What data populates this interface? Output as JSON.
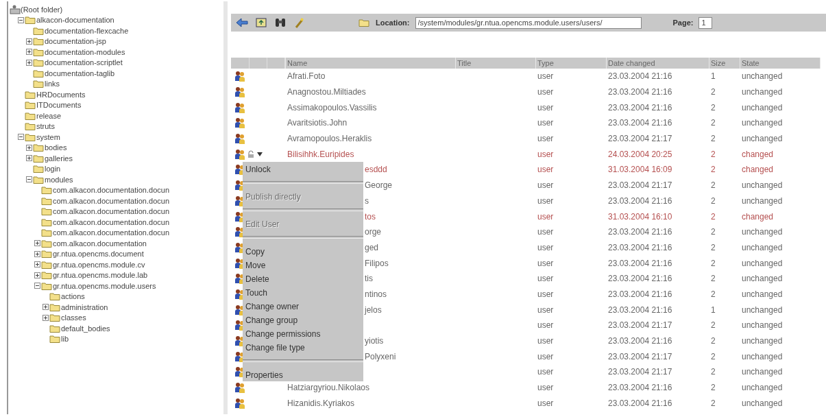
{
  "tree": {
    "label": "(Root folder)",
    "children": [
      {
        "label": "alkacon-documentation",
        "expanded": true,
        "children": [
          {
            "label": "documentation-flexcache"
          },
          {
            "label": "documentation-jsp",
            "expanded": false
          },
          {
            "label": "documentation-modules",
            "expanded": false
          },
          {
            "label": "documentation-scriptlet",
            "expanded": false
          },
          {
            "label": "documentation-taglib"
          },
          {
            "label": "links"
          }
        ]
      },
      {
        "label": "HRDocuments"
      },
      {
        "label": "ITDocuments"
      },
      {
        "label": "release"
      },
      {
        "label": "struts"
      },
      {
        "label": "system",
        "expanded": true,
        "children": [
          {
            "label": "bodies",
            "expanded": false
          },
          {
            "label": "galleries",
            "expanded": false
          },
          {
            "label": "login"
          },
          {
            "label": "modules",
            "expanded": true,
            "children": [
              {
                "label": "com.alkacon.documentation.docun"
              },
              {
                "label": "com.alkacon.documentation.docun"
              },
              {
                "label": "com.alkacon.documentation.docun"
              },
              {
                "label": "com.alkacon.documentation.docun"
              },
              {
                "label": "com.alkacon.documentation.docun"
              },
              {
                "label": "com.alkacon.documentation",
                "expanded": false
              },
              {
                "label": "gr.ntua.opencms.document",
                "expanded": false
              },
              {
                "label": "gr.ntua.opencms.module.cv",
                "expanded": false
              },
              {
                "label": "gr.ntua.opencms.module.lab",
                "expanded": false
              },
              {
                "label": "gr.ntua.opencms.module.users",
                "expanded": true,
                "children": [
                  {
                    "label": "actions"
                  },
                  {
                    "label": "administration",
                    "expanded": false
                  },
                  {
                    "label": "classes",
                    "expanded": false
                  },
                  {
                    "label": "default_bodies"
                  },
                  {
                    "label": "lib"
                  }
                ]
              }
            ]
          }
        ]
      }
    ]
  },
  "toolbar": {
    "location_label": "Location:",
    "location": "/system/modules/gr.ntua.opencms.module.users/users/",
    "page_label": "Page:",
    "page": "1"
  },
  "table": {
    "columns": [
      "Name",
      "Title",
      "Type",
      "Date changed",
      "Size",
      "State"
    ],
    "rows": [
      {
        "name": "Afrati.Foto",
        "type": "user",
        "date": "23.03.2004 21:16",
        "size": "1",
        "state": "unchanged",
        "modified": false,
        "locked": false,
        "covered": false
      },
      {
        "name": "Anagnostou.Miltiades",
        "type": "user",
        "date": "23.03.2004 21:16",
        "size": "2",
        "state": "unchanged",
        "modified": false,
        "locked": false,
        "covered": false
      },
      {
        "name": "Assimakopoulos.Vassilis",
        "type": "user",
        "date": "23.03.2004 21:16",
        "size": "2",
        "state": "unchanged",
        "modified": false,
        "locked": false,
        "covered": false
      },
      {
        "name": "Avaritsiotis.John",
        "type": "user",
        "date": "23.03.2004 21:16",
        "size": "2",
        "state": "unchanged",
        "modified": false,
        "locked": false,
        "covered": false
      },
      {
        "name": "Avramopoulos.Heraklis",
        "type": "user",
        "date": "23.03.2004 21:17",
        "size": "2",
        "state": "unchanged",
        "modified": false,
        "locked": false,
        "covered": false
      },
      {
        "name": "Bilisihhk.Euripides",
        "type": "user",
        "date": "24.03.2004 20:25",
        "size": "2",
        "state": "changed",
        "modified": true,
        "locked": true,
        "covered": false
      },
      {
        "name": "esddd",
        "type": "user",
        "date": "31.03.2004 16:09",
        "size": "2",
        "state": "changed",
        "modified": true,
        "covered": true
      },
      {
        "name": "George",
        "type": "user",
        "date": "23.03.2004 21:17",
        "size": "2",
        "state": "unchanged",
        "modified": false,
        "covered": true
      },
      {
        "name": "s",
        "type": "user",
        "date": "23.03.2004 21:16",
        "size": "2",
        "state": "unchanged",
        "modified": false,
        "covered": true
      },
      {
        "name": "tos",
        "type": "user",
        "date": "31.03.2004 16:10",
        "size": "2",
        "state": "changed",
        "modified": true,
        "covered": true
      },
      {
        "name": "orge",
        "type": "user",
        "date": "23.03.2004 21:16",
        "size": "2",
        "state": "unchanged",
        "modified": false,
        "covered": true
      },
      {
        "name": "ged",
        "type": "user",
        "date": "23.03.2004 21:16",
        "size": "2",
        "state": "unchanged",
        "modified": false,
        "covered": true
      },
      {
        "name": "Filipos",
        "type": "user",
        "date": "23.03.2004 21:16",
        "size": "2",
        "state": "unchanged",
        "modified": false,
        "covered": true
      },
      {
        "name": "tis",
        "type": "user",
        "date": "23.03.2004 21:16",
        "size": "2",
        "state": "unchanged",
        "modified": false,
        "covered": true
      },
      {
        "name": "ntinos",
        "type": "user",
        "date": "23.03.2004 21:16",
        "size": "2",
        "state": "unchanged",
        "modified": false,
        "covered": true
      },
      {
        "name": "jelos",
        "type": "user",
        "date": "23.03.2004 21:16",
        "size": "1",
        "state": "unchanged",
        "modified": false,
        "covered": true
      },
      {
        "type": "user",
        "date": "23.03.2004 21:17",
        "size": "2",
        "state": "unchanged",
        "modified": false
      },
      {
        "name": "yiotis",
        "type": "user",
        "date": "23.03.2004 21:16",
        "size": "2",
        "state": "unchanged",
        "modified": false,
        "covered": true
      },
      {
        "name": "Polyxeni",
        "type": "user",
        "date": "23.03.2004 21:17",
        "size": "2",
        "state": "unchanged",
        "modified": false,
        "covered": true
      },
      {
        "type": "user",
        "date": "23.03.2004 21:17",
        "size": "2",
        "state": "unchanged",
        "modified": false
      },
      {
        "name": "Hatziargyriou.Nikolaos",
        "type": "user",
        "date": "23.03.2004 21:16",
        "size": "2",
        "state": "unchanged",
        "modified": false,
        "locked": false,
        "covered": false
      },
      {
        "name": "Hizanidis.Kyriakos",
        "type": "user",
        "date": "23.03.2004 21:16",
        "size": "2",
        "state": "unchanged",
        "modified": false,
        "locked": false,
        "covered": false
      }
    ]
  },
  "context_menu": [
    {
      "kind": "item",
      "label": "Unlock",
      "disabled": false
    },
    {
      "kind": "separator"
    },
    {
      "kind": "item",
      "label": "Publish directly",
      "disabled": true
    },
    {
      "kind": "separator"
    },
    {
      "kind": "item",
      "label": "Edit User",
      "disabled": true
    },
    {
      "kind": "separator"
    },
    {
      "kind": "item",
      "label": "Copy",
      "disabled": false
    },
    {
      "kind": "item",
      "label": "Move",
      "disabled": false
    },
    {
      "kind": "item",
      "label": "Delete",
      "disabled": false
    },
    {
      "kind": "item",
      "label": "Touch",
      "disabled": false
    },
    {
      "kind": "item",
      "label": "Change owner",
      "disabled": false
    },
    {
      "kind": "item",
      "label": "Change group",
      "disabled": false
    },
    {
      "kind": "item",
      "label": "Change permissions",
      "disabled": false
    },
    {
      "kind": "item",
      "label": "Change file type",
      "disabled": false
    },
    {
      "kind": "separator"
    },
    {
      "kind": "item",
      "label": "Properties",
      "disabled": false
    }
  ]
}
